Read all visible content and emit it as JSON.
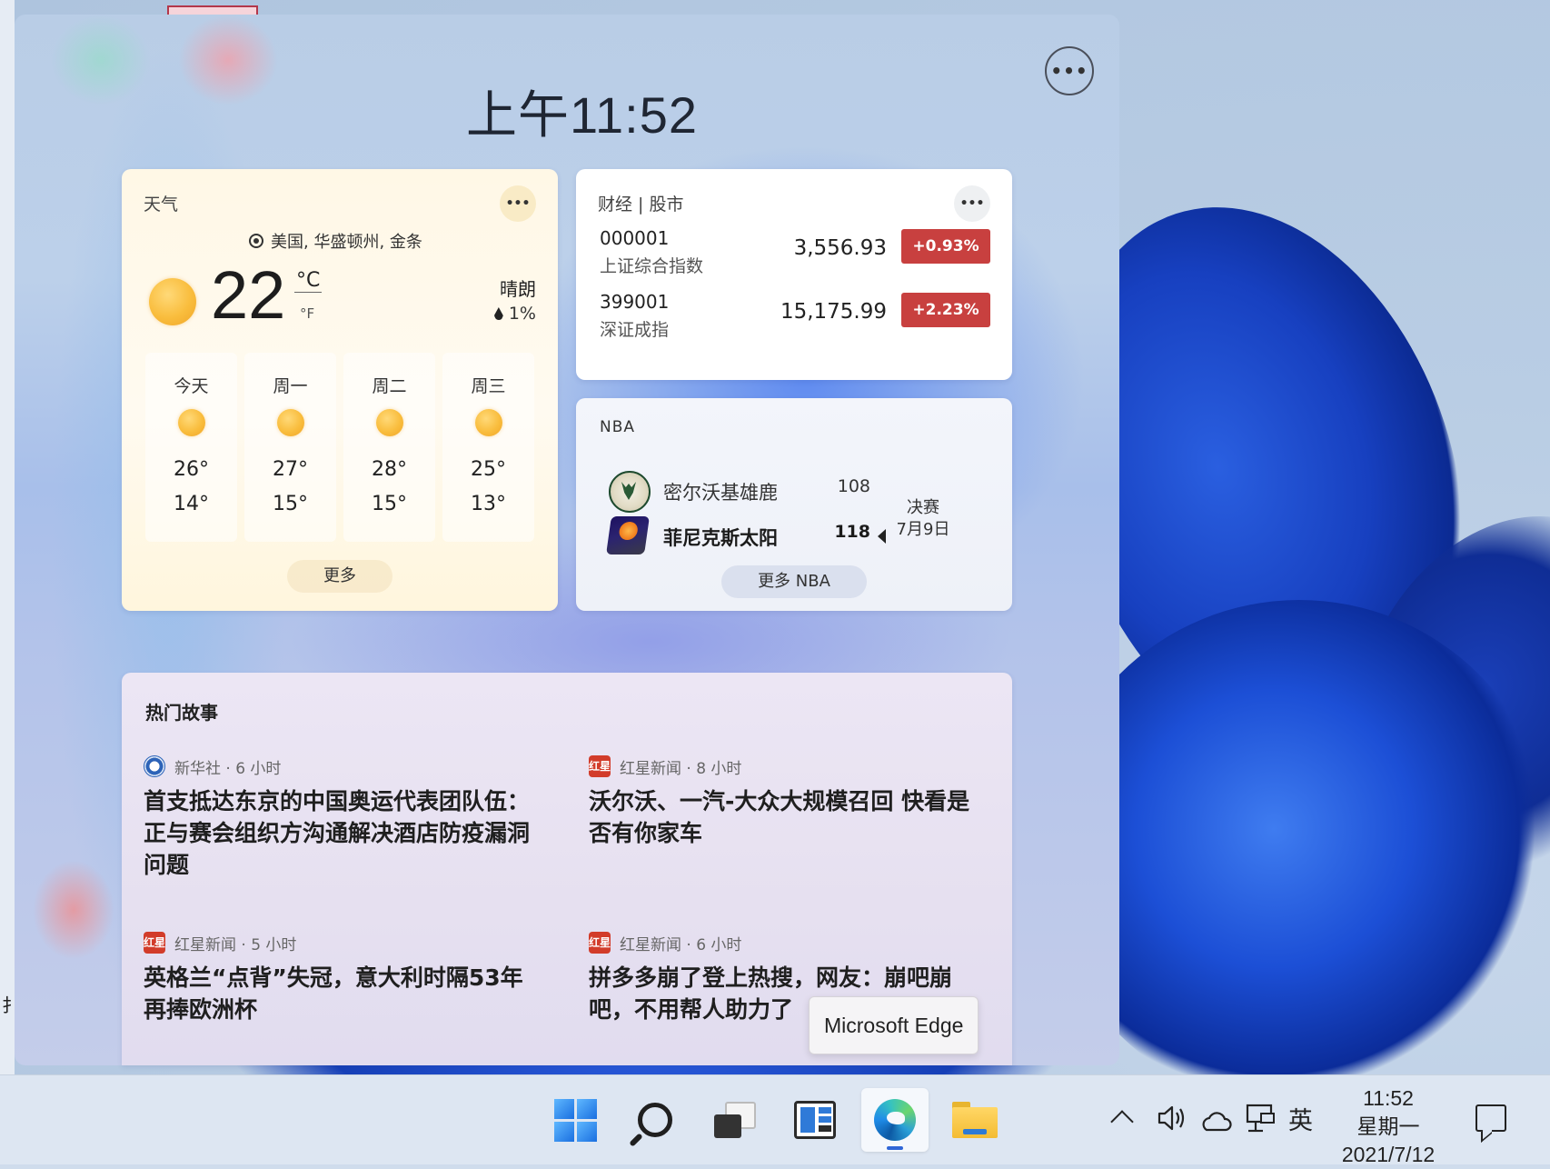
{
  "panel": {
    "time": "上午11:52",
    "more_label": "•••"
  },
  "weather": {
    "title": "天气",
    "more_label": "•••",
    "location": "美国, 华盛顿州, 金条",
    "temperature": "22",
    "unit_c": "°C",
    "unit_f": "°F",
    "condition": "晴朗",
    "precipitation": "1%",
    "forecast": [
      {
        "day": "今天",
        "high": "26°",
        "low": "14°",
        "icon": "sun-icon"
      },
      {
        "day": "周一",
        "high": "27°",
        "low": "15°",
        "icon": "sun-icon"
      },
      {
        "day": "周二",
        "high": "28°",
        "low": "15°",
        "icon": "sun-icon"
      },
      {
        "day": "周三",
        "high": "25°",
        "low": "13°",
        "icon": "sun-icon"
      }
    ],
    "more_button": "更多"
  },
  "finance": {
    "title": "财经 | 股市",
    "more_label": "•••",
    "stocks": [
      {
        "code": "000001",
        "name": "上证综合指数",
        "price": "3,556.93",
        "change": "+0.93%"
      },
      {
        "code": "399001",
        "name": "深证成指",
        "price": "15,175.99",
        "change": "+2.23%"
      }
    ],
    "change_color": "#c8403f"
  },
  "nba": {
    "title": "NBA",
    "teams": [
      {
        "name": "密尔沃基雄鹿",
        "score": "108",
        "logo": "bucks-logo"
      },
      {
        "name": "菲尼克斯太阳",
        "score": "118",
        "logo": "suns-logo"
      }
    ],
    "stage": "决赛",
    "date": "7月9日",
    "more_button": "更多 NBA"
  },
  "news": {
    "title": "热门故事",
    "stories": [
      {
        "source": "新华社 · 6 小时",
        "icon_text": "",
        "headline": "首支抵达东京的中国奥运代表团队伍：正与赛会组织方沟通解决酒店防疫漏洞问题"
      },
      {
        "source": "红星新闻 · 8 小时",
        "icon_text": "红星",
        "headline": "沃尔沃、一汽-大众大规模召回 快看是否有你家车"
      },
      {
        "source": "红星新闻 · 5 小时",
        "icon_text": "红星",
        "headline": "英格兰“点背”失冠，意大利时隔53年再捧欧洲杯"
      },
      {
        "source": "红星新闻 · 6 小时",
        "icon_text": "红星",
        "headline": "拼多多崩了登上热搜，网友：崩吧崩吧，不用帮人助力了"
      }
    ]
  },
  "tooltip": "Microsoft Edge",
  "taskbar": {
    "apps": [
      "start-icon",
      "search-icon",
      "task-view-icon",
      "widgets-icon",
      "edge-icon",
      "file-explorer-icon"
    ],
    "ime": "英",
    "time": "11:52",
    "weekday": "星期一",
    "date": "2021/7/12"
  },
  "desktop": {
    "edge_glyph": "扌"
  }
}
